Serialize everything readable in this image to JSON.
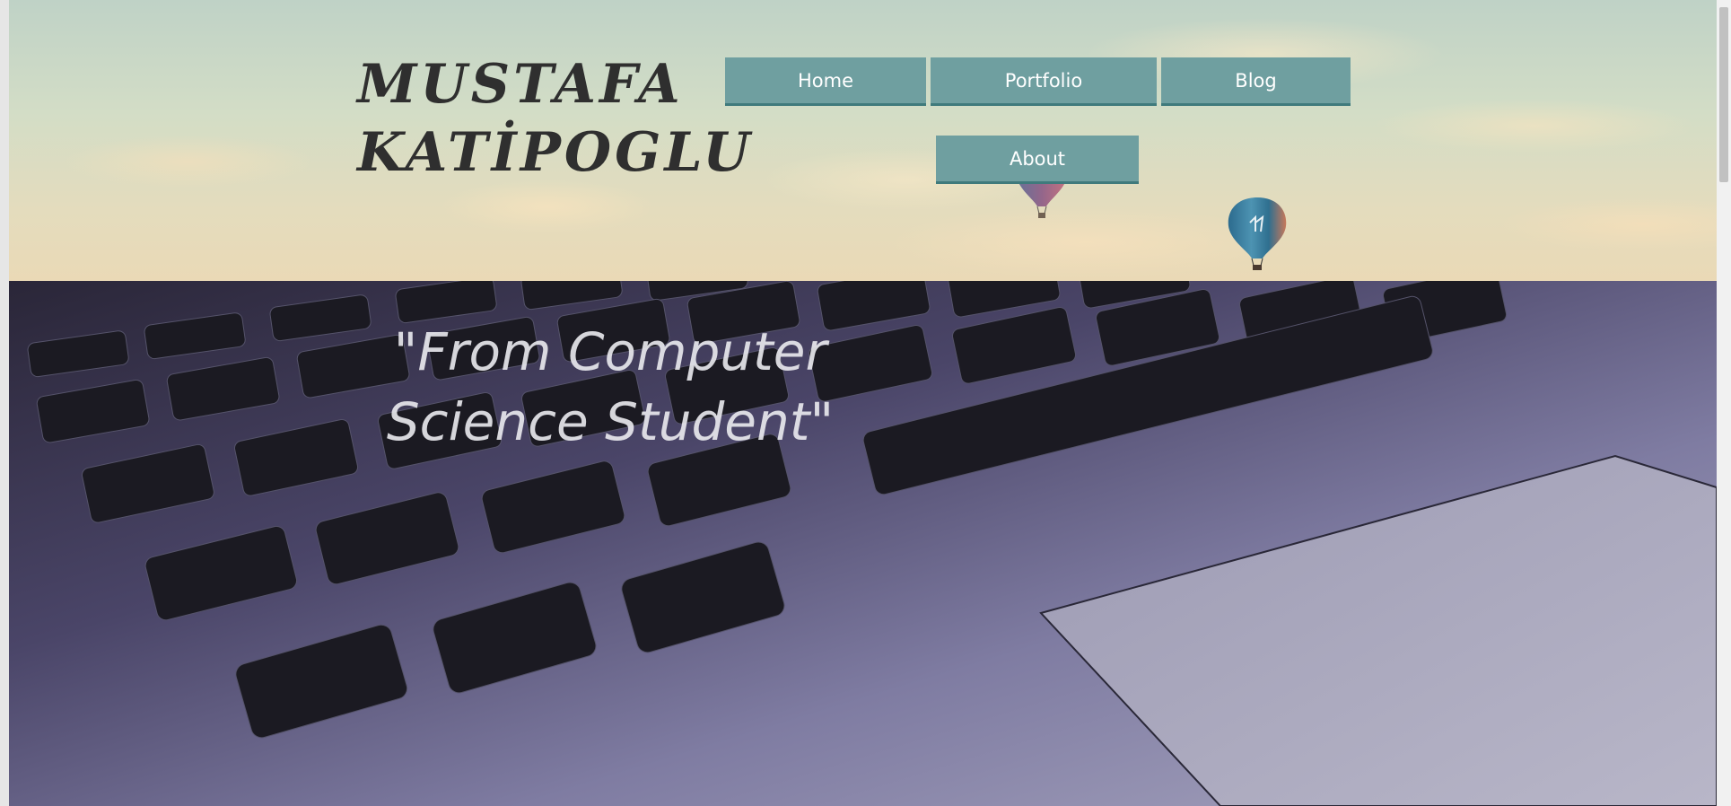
{
  "site": {
    "logo_line1": "MUSTAFA",
    "logo_line2": "KATİPOGLU"
  },
  "nav": {
    "items": [
      {
        "label": "Home"
      },
      {
        "label": "Portfolio"
      },
      {
        "label": "Blog"
      },
      {
        "label": "About"
      }
    ]
  },
  "hero": {
    "quote_line1": "\"From Computer",
    "quote_line2": "Science Student\""
  },
  "colors": {
    "nav_button": "#6f9fa0",
    "nav_border": "#3f7a7c",
    "logo_text": "#2f2f2f"
  }
}
